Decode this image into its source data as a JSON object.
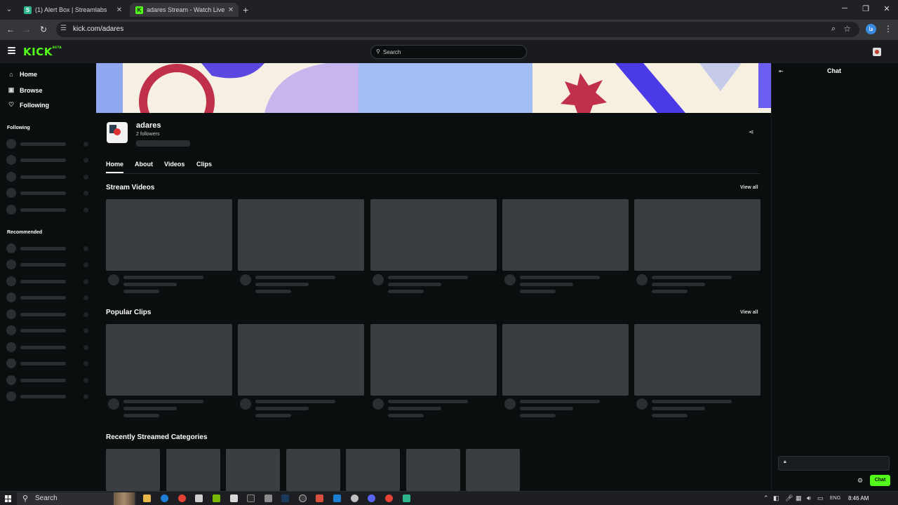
{
  "browser": {
    "tabs": [
      {
        "title": "(1) Alert Box | Streamlabs",
        "active": false
      },
      {
        "title": "adares Stream - Watch Live on",
        "active": true
      }
    ],
    "url": "kick.com/adares",
    "profile_initial": "فا"
  },
  "header": {
    "logo": "KICK",
    "logo_badge": "BETA",
    "search_placeholder": "Search"
  },
  "sidebar": {
    "nav": [
      {
        "label": "Home",
        "icon": "home-icon"
      },
      {
        "label": "Browse",
        "icon": "browse-icon"
      },
      {
        "label": "Following",
        "icon": "heart-icon"
      }
    ],
    "following_heading": "Following",
    "recommended_heading": "Recommended"
  },
  "channel": {
    "name": "adares",
    "followers": "2 followers",
    "tabs": [
      "Home",
      "About",
      "Videos",
      "Clips"
    ],
    "active_tab": "Home"
  },
  "sections": {
    "stream_videos": {
      "title": "Stream Videos",
      "view_all": "View all"
    },
    "popular_clips": {
      "title": "Popular Clips",
      "view_all": "View all"
    },
    "recent_categories": {
      "title": "Recently Streamed Categories"
    }
  },
  "chat": {
    "title": "Chat",
    "send_label": "Chat"
  },
  "taskbar": {
    "search_placeholder": "Search",
    "language": "ENG",
    "time": "8:46 AM"
  },
  "colors": {
    "brand": "#53fc18",
    "background": "#0b0e0f",
    "skeleton": "#3a3d41"
  }
}
